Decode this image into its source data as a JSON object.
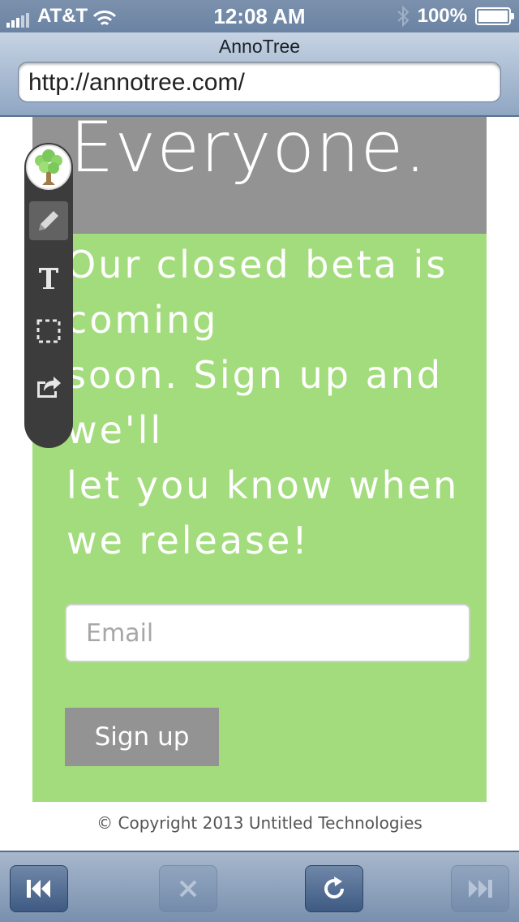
{
  "status_bar": {
    "carrier": "AT&T",
    "time": "12:08 AM",
    "battery": "100%"
  },
  "browser": {
    "title": "AnnoTree",
    "url": "http://annotree.com/"
  },
  "page": {
    "headline": "Everyone.",
    "lead_lines": [
      "Our closed beta is",
      "coming",
      "soon. Sign up and",
      "we'll",
      "let you know when",
      "we release!"
    ],
    "email_placeholder": "Email",
    "signup_label": "Sign up",
    "copyright": "© Copyright 2013 Untitled Technologies"
  },
  "annotree_toolbar": {
    "tools": [
      "pencil-icon",
      "text-icon",
      "select-box-icon",
      "share-icon"
    ]
  },
  "bottom_toolbar": {
    "buttons": [
      "back-icon",
      "stop-icon",
      "reload-icon",
      "forward-icon"
    ]
  },
  "colors": {
    "hero_gray": "#939393",
    "beta_green": "#a3dc7c",
    "toolbar_dark": "#3c3c3c"
  }
}
